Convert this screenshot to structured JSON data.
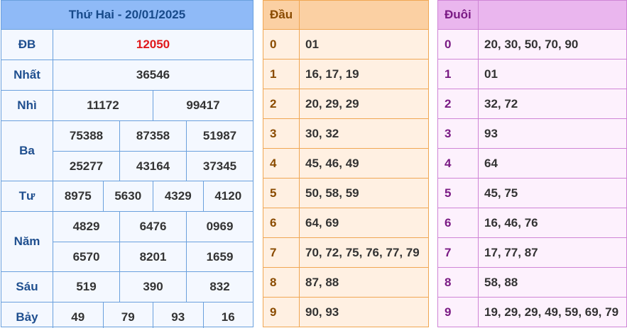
{
  "results": {
    "title": "Thứ Hai - 20/01/2025",
    "prizes": [
      {
        "label": "ĐB",
        "lines": [
          [
            "12050"
          ]
        ],
        "special": true
      },
      {
        "label": "Nhất",
        "lines": [
          [
            "36546"
          ]
        ]
      },
      {
        "label": "Nhì",
        "lines": [
          [
            "11172",
            "99417"
          ]
        ]
      },
      {
        "label": "Ba",
        "lines": [
          [
            "75388",
            "87358",
            "51987"
          ],
          [
            "25277",
            "43164",
            "37345"
          ]
        ]
      },
      {
        "label": "Tư",
        "lines": [
          [
            "8975",
            "5630",
            "4329",
            "4120"
          ]
        ]
      },
      {
        "label": "Năm",
        "lines": [
          [
            "4829",
            "6476",
            "0969"
          ],
          [
            "6570",
            "8201",
            "1659"
          ]
        ]
      },
      {
        "label": "Sáu",
        "lines": [
          [
            "519",
            "390",
            "832"
          ]
        ]
      },
      {
        "label": "Bảy",
        "lines": [
          [
            "49",
            "79",
            "93",
            "16"
          ]
        ]
      }
    ]
  },
  "dau": {
    "title": "Đầu",
    "rows": [
      {
        "k": "0",
        "v": "01"
      },
      {
        "k": "1",
        "v": "16, 17, 19"
      },
      {
        "k": "2",
        "v": "20, 29, 29"
      },
      {
        "k": "3",
        "v": "30, 32"
      },
      {
        "k": "4",
        "v": "45, 46, 49"
      },
      {
        "k": "5",
        "v": "50, 58, 59"
      },
      {
        "k": "6",
        "v": "64, 69"
      },
      {
        "k": "7",
        "v": "70, 72, 75, 76, 77, 79"
      },
      {
        "k": "8",
        "v": "87, 88"
      },
      {
        "k": "9",
        "v": "90, 93"
      }
    ]
  },
  "duoi": {
    "title": "Đuôi",
    "rows": [
      {
        "k": "0",
        "v": "20, 30, 50, 70, 90"
      },
      {
        "k": "1",
        "v": "01"
      },
      {
        "k": "2",
        "v": "32, 72"
      },
      {
        "k": "3",
        "v": "93"
      },
      {
        "k": "4",
        "v": "64"
      },
      {
        "k": "5",
        "v": "45, 75"
      },
      {
        "k": "6",
        "v": "16, 46, 76"
      },
      {
        "k": "7",
        "v": "17, 77, 87"
      },
      {
        "k": "8",
        "v": "58, 88"
      },
      {
        "k": "9",
        "v": "19, 29, 29, 49, 59, 69, 79"
      }
    ]
  },
  "colors": {
    "special_prize": "#e0191b",
    "results_header": "#8fbaf7",
    "dau_header": "#fbd0a3",
    "duoi_header": "#eab6ee"
  }
}
